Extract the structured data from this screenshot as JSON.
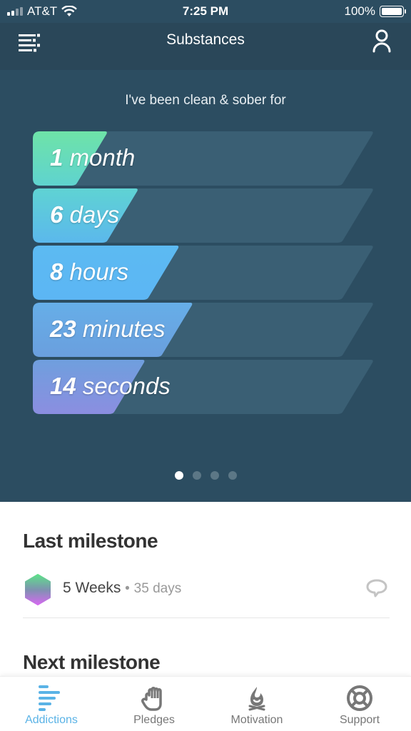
{
  "status_bar": {
    "carrier": "AT&T",
    "time": "7:25 PM",
    "battery": "100%"
  },
  "header": {
    "title": "Substances",
    "menu_icon": "list-menu-icon",
    "profile_icon": "user-icon"
  },
  "counter": {
    "intro": "I've been clean & sober for",
    "rows": [
      {
        "value": "1",
        "unit": "month",
        "fill_fraction": 0.22,
        "color_top": "#6ee3a8",
        "color_bottom": "#5fd3cf"
      },
      {
        "value": "6",
        "unit": "days",
        "fill_fraction": 0.31,
        "color_top": "#5fd3d3",
        "color_bottom": "#5bb8ec"
      },
      {
        "value": "8",
        "unit": "hours",
        "fill_fraction": 0.43,
        "color_top": "#5cbaf2",
        "color_bottom": "#5cb6f4"
      },
      {
        "value": "23",
        "unit": "minutes",
        "fill_fraction": 0.47,
        "color_top": "#66aee8",
        "color_bottom": "#6a9fde"
      },
      {
        "value": "14",
        "unit": "seconds",
        "fill_fraction": 0.33,
        "color_top": "#6f9fde",
        "color_bottom": "#8b8ee0"
      }
    ],
    "track_color": "#3a5f74",
    "pager": {
      "count": 4,
      "active": 0
    }
  },
  "last_milestone": {
    "heading": "Last milestone",
    "name": "5 Weeks",
    "separator": "•",
    "detail": "35 days"
  },
  "next_milestone": {
    "heading": "Next milestone"
  },
  "tabs": [
    {
      "label": "Addictions",
      "icon": "bars-icon",
      "active": true
    },
    {
      "label": "Pledges",
      "icon": "hand-icon",
      "active": false
    },
    {
      "label": "Motivation",
      "icon": "campfire-icon",
      "active": false
    },
    {
      "label": "Support",
      "icon": "lifebuoy-icon",
      "active": false
    }
  ],
  "colors": {
    "accent": "#5ab3e6",
    "header_bg": "#2a4759",
    "panel_bg": "#2c4d61"
  }
}
